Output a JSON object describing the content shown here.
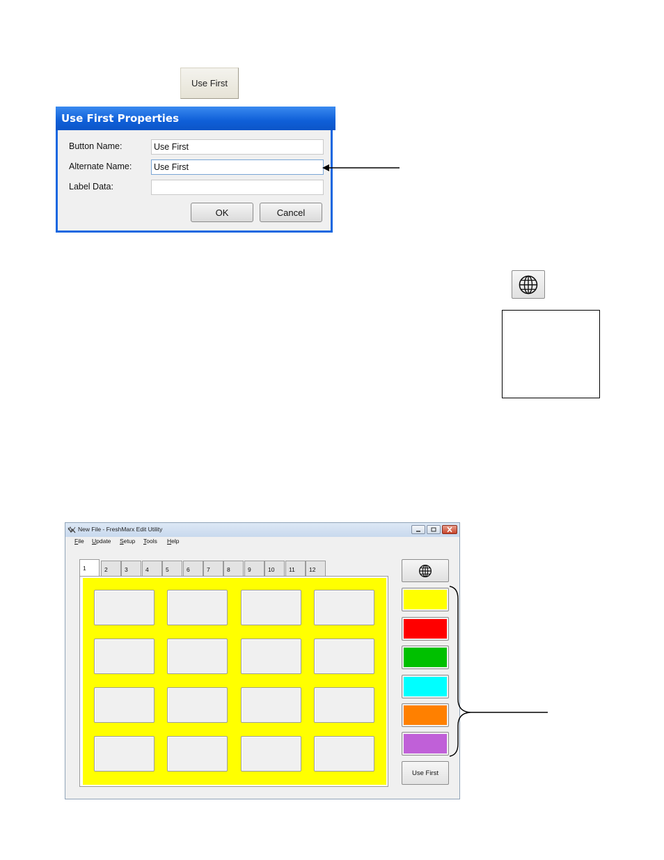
{
  "sample_button": {
    "label": "Use First"
  },
  "dialog": {
    "title": "Use First Properties",
    "fields": [
      {
        "label": "Button Name:",
        "value": "Use First"
      },
      {
        "label": "Alternate Name:",
        "value": "Use First"
      },
      {
        "label": "Label Data:",
        "value": ""
      }
    ],
    "ok_label": "OK",
    "cancel_label": "Cancel"
  },
  "app": {
    "window_title": "New File - FreshMarx Edit Utility",
    "window_controls": [
      "minimize",
      "maximize",
      "close"
    ],
    "menu": [
      {
        "accel": "F",
        "rest": "ile"
      },
      {
        "accel": "U",
        "rest": "pdate"
      },
      {
        "accel": "S",
        "rest": "etup"
      },
      {
        "accel": "T",
        "rest": "ools"
      },
      {
        "accel": "H",
        "rest": "elp"
      }
    ],
    "tabs": [
      "1",
      "2",
      "3",
      "4",
      "5",
      "6",
      "7",
      "8",
      "9",
      "10",
      "11",
      "12"
    ],
    "active_tab": "1",
    "panel_color": "#ffff00",
    "grid": {
      "rows": 4,
      "columns": 4
    },
    "color_buttons": [
      {
        "name": "yellow",
        "color": "#ffff00"
      },
      {
        "name": "red",
        "color": "#ff0000"
      },
      {
        "name": "green",
        "color": "#00c000"
      },
      {
        "name": "cyan",
        "color": "#00ffff"
      },
      {
        "name": "orange",
        "color": "#ff8000"
      },
      {
        "name": "purple",
        "color": "#c060d8"
      }
    ],
    "use_first_label": "Use First",
    "globe_icon": "globe-icon"
  }
}
